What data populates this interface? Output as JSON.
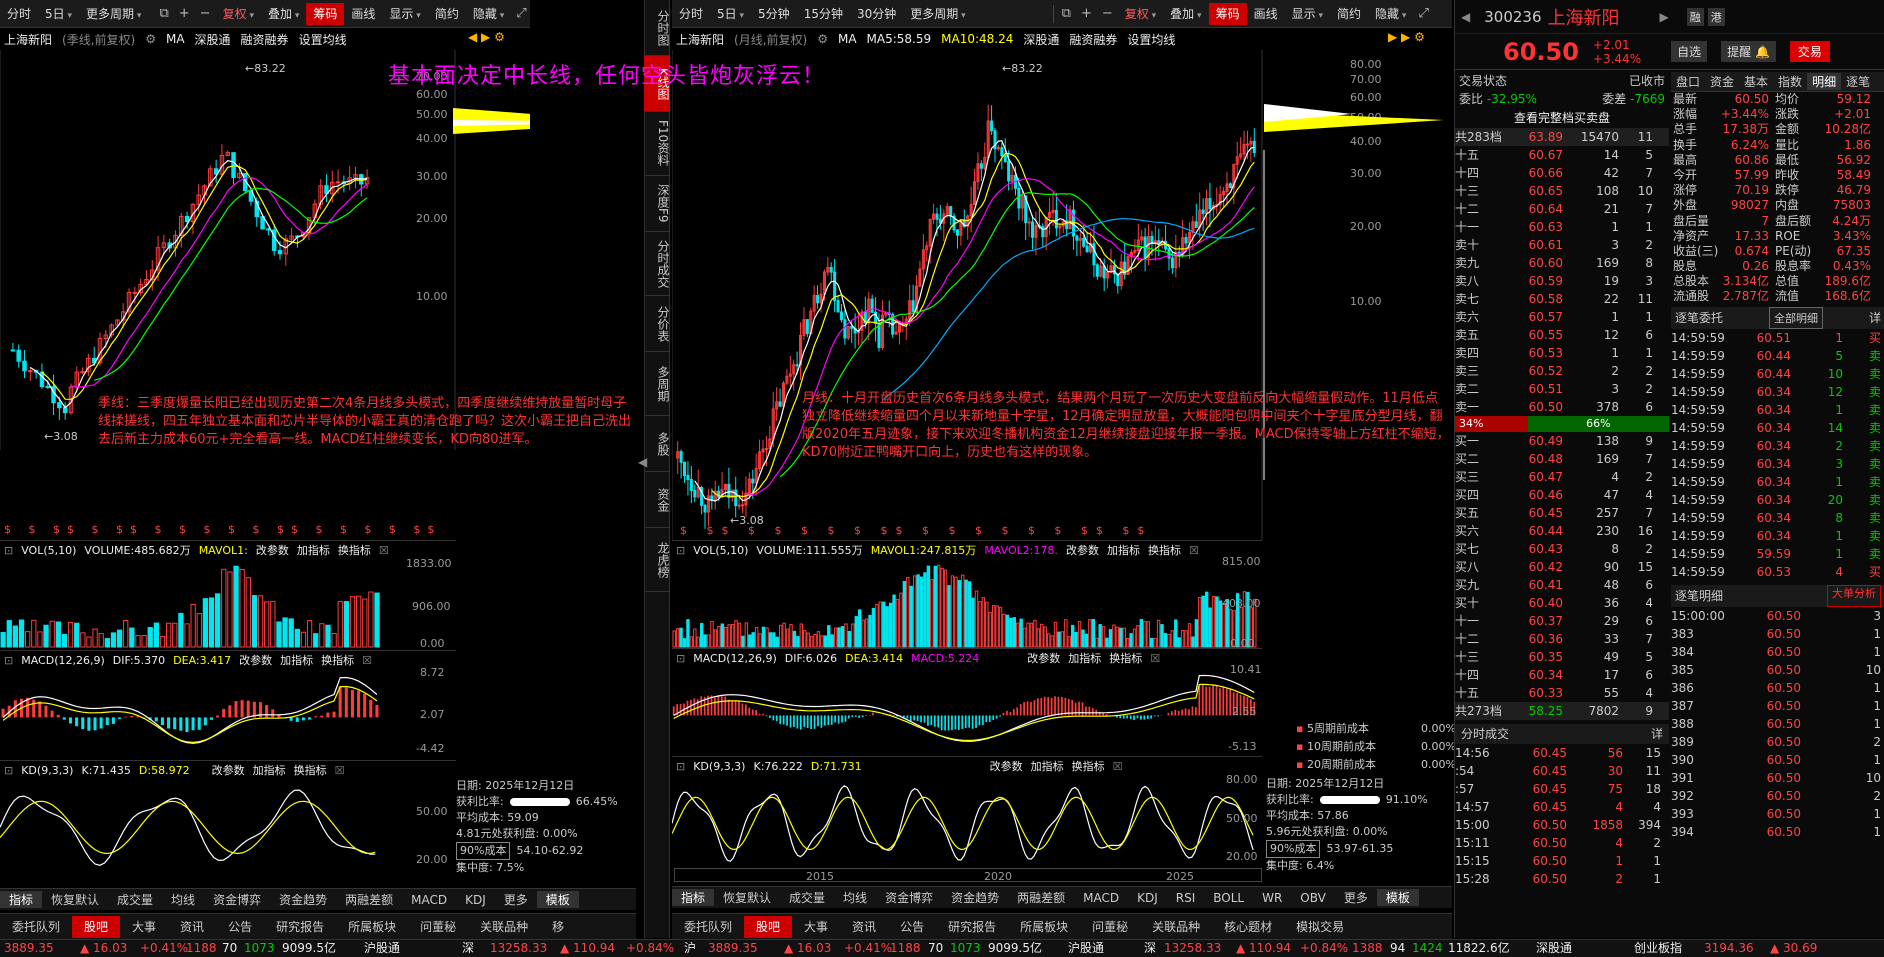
{
  "left_toolbar": [
    "分时",
    "5日",
    "更多周期",
    "复权",
    "叠加",
    "筹码",
    "画线",
    "显示",
    "简约",
    "隐藏"
  ],
  "right_toolbar": [
    "分时",
    "5日",
    "5分钟",
    "15分钟",
    "30分钟",
    "更多周期",
    "复权",
    "叠加",
    "筹码",
    "画线",
    "显示",
    "简约",
    "隐藏"
  ],
  "left_chart": {
    "header": {
      "name": "上海新阳",
      "mode": "(季线,前复权)",
      "ma_label": "MA",
      "ma_extra": "深股通",
      "rz": "融资融券",
      "setup": "设置均线"
    },
    "y_ticks": [
      "70.00",
      "60.00",
      "50.00",
      "40.00",
      "30.00",
      "20.00",
      "10.00"
    ],
    "high": "83.22",
    "low": "3.08",
    "vol": {
      "name": "VOL(5,10)",
      "value": "VOLUME:485.682万",
      "ma": "MAVOL1:",
      "btns": [
        "改参数",
        "加指标",
        "换指标"
      ],
      "y": [
        "1833.00",
        "906.00",
        "0.00"
      ]
    },
    "macd": {
      "name": "MACD(12,26,9)",
      "dif": "DIF:5.370",
      "dea": "DEA:3.417",
      "btns": [
        "改参数",
        "加指标",
        "换指标"
      ],
      "y": [
        "8.72",
        "2.07",
        "-4.42"
      ]
    },
    "kd": {
      "name": "KD(9,3,3)",
      "k": "K:71.435",
      "d": "D:58.972",
      "btns": [
        "改参数",
        "加指标",
        "换指标"
      ],
      "y": [
        "50.00",
        "20.00"
      ]
    },
    "stats": {
      "date": "日期: 2025年12月12日",
      "profit_label": "获利比率:",
      "profit_val": "66.45%",
      "avg": "平均成本: 59.09",
      "p481": "4.81元处获利盘: 0.00%",
      "cost": "90%成本",
      "range": "54.10-62.92",
      "conc": "集中度: 7.5%"
    },
    "annotation": "季线：三季度爆量长阳已经出现历史第二次4条月线多头模式，四季度继续维持放量暂时母子线揉搓线，四五年独立基本面和芯片半导体的小霸王真的清仓跑了吗？这次小霸王把自己洗出去后新主力成本60元+完全看高一线。MACD红柱继续变长，KD向80进军。",
    "tabs": [
      "指标",
      "恢复默认",
      "成交量",
      "均线",
      "资金博弈",
      "资金趋势",
      "两融差额",
      "MACD",
      "KDJ",
      "更多",
      "模板"
    ],
    "bottom_tabs": [
      "委托队列",
      "股吧",
      "大事",
      "资讯",
      "公告",
      "研究报告",
      "所属板块",
      "问董秘",
      "关联品种",
      "移"
    ]
  },
  "headline": "基本面决定中长线，任何空头皆炮灰浮云！",
  "mid_tabs": [
    "分时图",
    "K线图",
    "F10资料",
    "深度F9",
    "分时成交",
    "分价表",
    "多周期",
    "多股",
    "资金",
    "龙虎榜"
  ],
  "right_chart": {
    "header": {
      "name": "上海新阳",
      "mode": "(月线,前复权)",
      "ma_label": "MA",
      "ma5": "MA5:58.59",
      "ma10": "MA10:48.24",
      "extra": "深股通",
      "rz": "融资融券",
      "setup": "设置均线"
    },
    "y_ticks": [
      "80.00",
      "70.00",
      "60.00",
      "50.00",
      "40.00",
      "30.00",
      "20.00",
      "10.00"
    ],
    "high": "83.22",
    "low": "3.08",
    "vol": {
      "name": "VOL(5,10)",
      "value": "VOLUME:111.555万",
      "ma1": "MAVOL1:247.815万",
      "ma2": "MAVOL2:178.",
      "btns": [
        "改参数",
        "加指标",
        "换指标"
      ],
      "y": [
        "815.00",
        "403.00",
        "0.00"
      ]
    },
    "macd": {
      "name": "MACD(12,26,9)",
      "dif": "DIF:6.026",
      "dea": "DEA:3.414",
      "macd": "MACD:5.224",
      "btns": [
        "改参数",
        "加指标",
        "换指标"
      ],
      "y": [
        "10.41",
        "2.55",
        "-5.13"
      ]
    },
    "kd": {
      "name": "KD(9,3,3)",
      "k": "K:76.222",
      "d": "D:71.731",
      "btns": [
        "改参数",
        "加指标",
        "换指标"
      ],
      "y": [
        "80.00",
        "50.00",
        "20.00"
      ]
    },
    "x_labels": [
      "2015",
      "2020",
      "2025"
    ],
    "stats": {
      "w5": "5周期前成本",
      "w5v": "0.00%",
      "w10": "10周期前成本",
      "w10v": "0.00%",
      "w20": "20周期前成本",
      "w20v": "0.00%",
      "date": "日期: 2025年12月12日",
      "profit_label": "获利比率:",
      "profit_val": "91.10%",
      "avg": "平均成本: 57.86",
      "p596": "5.96元处获利盘: 0.00%",
      "cost": "90%成本",
      "range": "53.97-61.35",
      "conc": "集中度: 6.4%"
    },
    "annotation": "月线：十月开盘历史首次6条月线多头模式，结果两个月玩了一次历史大变盘前反向大幅缩量假动作。11月低点独立降低继续缩量四个月以来新地量十字星，12月确定明显放量，大概能阳包阴中间夹个十字星底分型月线，翻版2020年五月迹象，接下来欢迎冬播机构资金12月继续接盘迎接年报一季报。MACD保持零轴上方红柱不缩短，KD70附近正鸭嘴开口向上，历史也有这样的现象。",
    "tabs": [
      "指标",
      "恢复默认",
      "成交量",
      "均线",
      "资金博弈",
      "资金趋势",
      "两融差额",
      "MACD",
      "KDJ",
      "RSI",
      "BOLL",
      "WR",
      "OBV",
      "更多",
      "模板"
    ],
    "bottom_tabs": [
      "委托队列",
      "股吧",
      "大事",
      "资讯",
      "公告",
      "研究报告",
      "所属板块",
      "问董秘",
      "关联品种",
      "核心题材",
      "模拟交易"
    ]
  },
  "quote": {
    "code": "300236",
    "name": "上海新阳",
    "badge1": "融",
    "badge2": "港",
    "price": "60.50",
    "chg": "+2.01",
    "pct": "+3.44%",
    "btn_add": "自选",
    "btn_alert": "提醒",
    "btn_trade": "交易",
    "state_label": "交易状态",
    "state_val": "已收市",
    "wb_label": "委比",
    "wb_val": "-32.95%",
    "wc_label": "委差",
    "wc_val": "-7669",
    "full_btn": "查看完整档买卖盘",
    "sell_head": {
      "label": "共283档",
      "p": "63.89",
      "v": "15470",
      "c": "11"
    },
    "sells": [
      [
        "十五",
        "60.67",
        "14",
        "5"
      ],
      [
        "十四",
        "60.66",
        "42",
        "7"
      ],
      [
        "十三",
        "60.65",
        "108",
        "10"
      ],
      [
        "十二",
        "60.64",
        "21",
        "7"
      ],
      [
        "十一",
        "60.63",
        "1",
        "1"
      ],
      [
        "卖十",
        "60.61",
        "3",
        "2"
      ],
      [
        "卖九",
        "60.60",
        "169",
        "8"
      ],
      [
        "卖八",
        "60.59",
        "19",
        "3"
      ],
      [
        "卖七",
        "60.58",
        "22",
        "11"
      ],
      [
        "卖六",
        "60.57",
        "1",
        "1"
      ],
      [
        "卖五",
        "60.55",
        "12",
        "6"
      ],
      [
        "卖四",
        "60.53",
        "1",
        "1"
      ],
      [
        "卖三",
        "60.52",
        "2",
        "2"
      ],
      [
        "卖二",
        "60.51",
        "3",
        "2"
      ],
      [
        "卖一",
        "60.50",
        "378",
        "6"
      ]
    ],
    "ratio_l": "34%",
    "ratio_r": "66%",
    "buys": [
      [
        "买一",
        "60.49",
        "138",
        "9"
      ],
      [
        "买二",
        "60.48",
        "169",
        "7"
      ],
      [
        "买三",
        "60.47",
        "4",
        "2"
      ],
      [
        "买四",
        "60.46",
        "47",
        "4"
      ],
      [
        "买五",
        "60.45",
        "257",
        "7"
      ],
      [
        "买六",
        "60.44",
        "230",
        "16"
      ],
      [
        "买七",
        "60.43",
        "8",
        "2"
      ],
      [
        "买八",
        "60.42",
        "90",
        "15"
      ],
      [
        "买九",
        "60.41",
        "48",
        "6"
      ],
      [
        "买十",
        "60.40",
        "36",
        "4"
      ],
      [
        "十一",
        "60.37",
        "29",
        "6"
      ],
      [
        "十二",
        "60.36",
        "33",
        "7"
      ],
      [
        "十三",
        "60.35",
        "49",
        "5"
      ],
      [
        "十四",
        "60.34",
        "17",
        "6"
      ],
      [
        "十五",
        "60.33",
        "55",
        "4"
      ]
    ],
    "buy_foot": {
      "label": "共273档",
      "p": "58.25",
      "v": "7802",
      "c": "9"
    },
    "tabs": [
      "盘口",
      "资金",
      "基本",
      "指数",
      "明细",
      "逐笔"
    ],
    "kv": [
      [
        "最新",
        "60.50",
        "均价",
        "59.12"
      ],
      [
        "涨幅",
        "+3.44%",
        "涨跌",
        "+2.01"
      ],
      [
        "总手",
        "17.38万",
        "金额",
        "10.28亿"
      ],
      [
        "换手",
        "6.24%",
        "量比",
        "1.86"
      ],
      [
        "最高",
        "60.86",
        "最低",
        "56.92"
      ],
      [
        "今开",
        "57.99",
        "昨收",
        "58.49"
      ],
      [
        "涨停",
        "70.19",
        "跌停",
        "46.79"
      ],
      [
        "外盘",
        "98027",
        "内盘",
        "75803"
      ],
      [
        "盘后量",
        "7",
        "盘后额",
        "4.24万"
      ],
      [
        "净资产",
        "17.33",
        "ROE",
        "3.43%"
      ],
      [
        "收益(三)",
        "0.674",
        "PE(动)",
        "67.35"
      ],
      [
        "股息",
        "0.26",
        "股息率",
        "0.43%"
      ],
      [
        "总股本",
        "3.134亿",
        "总值",
        "189.6亿"
      ],
      [
        "流通股",
        "2.787亿",
        "流值",
        "168.6亿"
      ]
    ],
    "zb_title": "逐笔委托",
    "zb_sel": "全部明细",
    "zb_rows": [
      [
        "14:59:59",
        "60.51",
        "1",
        "买"
      ],
      [
        "14:59:59",
        "60.44",
        "5",
        "卖"
      ],
      [
        "14:59:59",
        "60.44",
        "10",
        "卖"
      ],
      [
        "14:59:59",
        "60.34",
        "12",
        "卖"
      ],
      [
        "14:59:59",
        "60.34",
        "1",
        "卖"
      ],
      [
        "14:59:59",
        "60.34",
        "14",
        "卖"
      ],
      [
        "14:59:59",
        "60.34",
        "2",
        "卖"
      ],
      [
        "14:59:59",
        "60.34",
        "3",
        "卖"
      ],
      [
        "14:59:59",
        "60.34",
        "1",
        "卖"
      ],
      [
        "14:59:59",
        "60.34",
        "20",
        "卖"
      ],
      [
        "14:59:59",
        "60.34",
        "8",
        "卖"
      ],
      [
        "14:59:59",
        "60.34",
        "1",
        "卖"
      ],
      [
        "14:59:59",
        "59.59",
        "1",
        "卖"
      ],
      [
        "14:59:59",
        "60.53",
        "4",
        "买"
      ]
    ],
    "mx_title": "逐笔明细",
    "mx_btn": "大单分析",
    "mx_rows": [
      [
        "15:00:00",
        "60.50",
        "3"
      ],
      [
        "383",
        "60.50",
        "1"
      ],
      [
        "384",
        "60.50",
        "1"
      ],
      [
        "385",
        "60.50",
        "10"
      ],
      [
        "386",
        "60.50",
        "1"
      ],
      [
        "387",
        "60.50",
        "1"
      ],
      [
        "388",
        "60.50",
        "1"
      ],
      [
        "389",
        "60.50",
        "2"
      ],
      [
        "390",
        "60.50",
        "1"
      ],
      [
        "391",
        "60.50",
        "10"
      ],
      [
        "392",
        "60.50",
        "2"
      ],
      [
        "393",
        "60.50",
        "1"
      ],
      [
        "394",
        "60.50",
        "1"
      ]
    ],
    "fs_title": "分时成交",
    "fs_rows": [
      [
        "14:56",
        "60.45",
        "56",
        "15"
      ],
      [
        ":54",
        "60.45",
        "30",
        "11"
      ],
      [
        ":57",
        "60.45",
        "75",
        "18"
      ],
      [
        "14:57",
        "60.45",
        "4",
        "4"
      ],
      [
        "15:00",
        "60.50",
        "1858",
        "394"
      ],
      [
        "15:11",
        "60.50",
        "4",
        "2"
      ],
      [
        "15:15",
        "60.50",
        "1",
        "1"
      ],
      [
        "15:28",
        "60.50",
        "2",
        "1"
      ]
    ]
  },
  "status": {
    "a": "3889.35",
    "b": "16.03",
    "c": "+0.41%",
    "d": "1188",
    "e": "70",
    "f": "1073",
    "g": "9099.5亿",
    "h": "沪股通",
    "i": "深",
    "j": "13258.33",
    "k": "110.94",
    "l": "+0.84%",
    "m": "1388",
    "n": "94",
    "o": "1424",
    "p": "11822.6亿",
    "q": "深股通",
    "r": "创业板指",
    "s": "3194.36",
    "t": "30.69"
  }
}
